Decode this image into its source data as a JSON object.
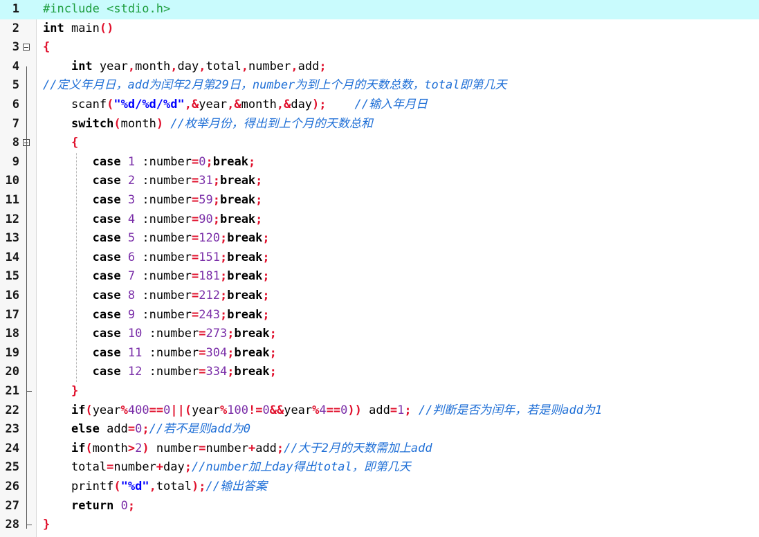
{
  "editor": {
    "current_line": 1,
    "lines": [
      {
        "num": "1",
        "segs": [
          {
            "t": "pp",
            "v": "#include <stdio.h>"
          }
        ]
      },
      {
        "num": "2",
        "segs": [
          {
            "t": "k",
            "v": "int"
          },
          {
            "t": "plain",
            "v": " main"
          },
          {
            "t": "o",
            "v": "()"
          }
        ]
      },
      {
        "num": "3",
        "fold": "open",
        "segs": [
          {
            "t": "o",
            "v": "{"
          }
        ]
      },
      {
        "num": "4",
        "segs": [
          {
            "t": "plain",
            "v": "    "
          },
          {
            "t": "k",
            "v": "int"
          },
          {
            "t": "plain",
            "v": " year"
          },
          {
            "t": "o",
            "v": ","
          },
          {
            "t": "plain",
            "v": "month"
          },
          {
            "t": "o",
            "v": ","
          },
          {
            "t": "plain",
            "v": "day"
          },
          {
            "t": "o",
            "v": ","
          },
          {
            "t": "plain",
            "v": "total"
          },
          {
            "t": "o",
            "v": ","
          },
          {
            "t": "plain",
            "v": "number"
          },
          {
            "t": "o",
            "v": ","
          },
          {
            "t": "plain",
            "v": "add"
          },
          {
            "t": "o",
            "v": ";"
          }
        ]
      },
      {
        "num": "5",
        "segs": [
          {
            "t": "c",
            "v": "//定义年月日，add为闰年2月第29日，number为到上个月的天数总数，total即第几天"
          }
        ]
      },
      {
        "num": "6",
        "segs": [
          {
            "t": "plain",
            "v": "    scanf"
          },
          {
            "t": "o",
            "v": "("
          },
          {
            "t": "s",
            "v": "\"%d/%d/%d\""
          },
          {
            "t": "o",
            "v": ",&"
          },
          {
            "t": "plain",
            "v": "year"
          },
          {
            "t": "o",
            "v": ",&"
          },
          {
            "t": "plain",
            "v": "month"
          },
          {
            "t": "o",
            "v": ",&"
          },
          {
            "t": "plain",
            "v": "day"
          },
          {
            "t": "o",
            "v": ");"
          },
          {
            "t": "plain",
            "v": "    "
          },
          {
            "t": "c",
            "v": "//输入年月日"
          }
        ]
      },
      {
        "num": "7",
        "segs": [
          {
            "t": "plain",
            "v": "    "
          },
          {
            "t": "k",
            "v": "switch"
          },
          {
            "t": "o",
            "v": "("
          },
          {
            "t": "plain",
            "v": "month"
          },
          {
            "t": "o",
            "v": ")"
          },
          {
            "t": "plain",
            "v": " "
          },
          {
            "t": "c",
            "v": "//枚举月份，得出到上个月的天数总和"
          }
        ]
      },
      {
        "num": "8",
        "fold": "open",
        "segs": [
          {
            "t": "plain",
            "v": "    "
          },
          {
            "t": "o",
            "v": "{"
          }
        ]
      },
      {
        "num": "9",
        "segs": [
          {
            "t": "plain",
            "v": "       "
          },
          {
            "t": "k",
            "v": "case"
          },
          {
            "t": "plain",
            "v": " "
          },
          {
            "t": "n",
            "v": "1"
          },
          {
            "t": "plain",
            "v": " :number"
          },
          {
            "t": "o",
            "v": "="
          },
          {
            "t": "n",
            "v": "0"
          },
          {
            "t": "o",
            "v": ";"
          },
          {
            "t": "k",
            "v": "break"
          },
          {
            "t": "o",
            "v": ";"
          }
        ]
      },
      {
        "num": "10",
        "segs": [
          {
            "t": "plain",
            "v": "       "
          },
          {
            "t": "k",
            "v": "case"
          },
          {
            "t": "plain",
            "v": " "
          },
          {
            "t": "n",
            "v": "2"
          },
          {
            "t": "plain",
            "v": " :number"
          },
          {
            "t": "o",
            "v": "="
          },
          {
            "t": "n",
            "v": "31"
          },
          {
            "t": "o",
            "v": ";"
          },
          {
            "t": "k",
            "v": "break"
          },
          {
            "t": "o",
            "v": ";"
          }
        ]
      },
      {
        "num": "11",
        "segs": [
          {
            "t": "plain",
            "v": "       "
          },
          {
            "t": "k",
            "v": "case"
          },
          {
            "t": "plain",
            "v": " "
          },
          {
            "t": "n",
            "v": "3"
          },
          {
            "t": "plain",
            "v": " :number"
          },
          {
            "t": "o",
            "v": "="
          },
          {
            "t": "n",
            "v": "59"
          },
          {
            "t": "o",
            "v": ";"
          },
          {
            "t": "k",
            "v": "break"
          },
          {
            "t": "o",
            "v": ";"
          }
        ]
      },
      {
        "num": "12",
        "segs": [
          {
            "t": "plain",
            "v": "       "
          },
          {
            "t": "k",
            "v": "case"
          },
          {
            "t": "plain",
            "v": " "
          },
          {
            "t": "n",
            "v": "4"
          },
          {
            "t": "plain",
            "v": " :number"
          },
          {
            "t": "o",
            "v": "="
          },
          {
            "t": "n",
            "v": "90"
          },
          {
            "t": "o",
            "v": ";"
          },
          {
            "t": "k",
            "v": "break"
          },
          {
            "t": "o",
            "v": ";"
          }
        ]
      },
      {
        "num": "13",
        "segs": [
          {
            "t": "plain",
            "v": "       "
          },
          {
            "t": "k",
            "v": "case"
          },
          {
            "t": "plain",
            "v": " "
          },
          {
            "t": "n",
            "v": "5"
          },
          {
            "t": "plain",
            "v": " :number"
          },
          {
            "t": "o",
            "v": "="
          },
          {
            "t": "n",
            "v": "120"
          },
          {
            "t": "o",
            "v": ";"
          },
          {
            "t": "k",
            "v": "break"
          },
          {
            "t": "o",
            "v": ";"
          }
        ]
      },
      {
        "num": "14",
        "segs": [
          {
            "t": "plain",
            "v": "       "
          },
          {
            "t": "k",
            "v": "case"
          },
          {
            "t": "plain",
            "v": " "
          },
          {
            "t": "n",
            "v": "6"
          },
          {
            "t": "plain",
            "v": " :number"
          },
          {
            "t": "o",
            "v": "="
          },
          {
            "t": "n",
            "v": "151"
          },
          {
            "t": "o",
            "v": ";"
          },
          {
            "t": "k",
            "v": "break"
          },
          {
            "t": "o",
            "v": ";"
          }
        ]
      },
      {
        "num": "15",
        "segs": [
          {
            "t": "plain",
            "v": "       "
          },
          {
            "t": "k",
            "v": "case"
          },
          {
            "t": "plain",
            "v": " "
          },
          {
            "t": "n",
            "v": "7"
          },
          {
            "t": "plain",
            "v": " :number"
          },
          {
            "t": "o",
            "v": "="
          },
          {
            "t": "n",
            "v": "181"
          },
          {
            "t": "o",
            "v": ";"
          },
          {
            "t": "k",
            "v": "break"
          },
          {
            "t": "o",
            "v": ";"
          }
        ]
      },
      {
        "num": "16",
        "segs": [
          {
            "t": "plain",
            "v": "       "
          },
          {
            "t": "k",
            "v": "case"
          },
          {
            "t": "plain",
            "v": " "
          },
          {
            "t": "n",
            "v": "8"
          },
          {
            "t": "plain",
            "v": " :number"
          },
          {
            "t": "o",
            "v": "="
          },
          {
            "t": "n",
            "v": "212"
          },
          {
            "t": "o",
            "v": ";"
          },
          {
            "t": "k",
            "v": "break"
          },
          {
            "t": "o",
            "v": ";"
          }
        ]
      },
      {
        "num": "17",
        "segs": [
          {
            "t": "plain",
            "v": "       "
          },
          {
            "t": "k",
            "v": "case"
          },
          {
            "t": "plain",
            "v": " "
          },
          {
            "t": "n",
            "v": "9"
          },
          {
            "t": "plain",
            "v": " :number"
          },
          {
            "t": "o",
            "v": "="
          },
          {
            "t": "n",
            "v": "243"
          },
          {
            "t": "o",
            "v": ";"
          },
          {
            "t": "k",
            "v": "break"
          },
          {
            "t": "o",
            "v": ";"
          }
        ]
      },
      {
        "num": "18",
        "segs": [
          {
            "t": "plain",
            "v": "       "
          },
          {
            "t": "k",
            "v": "case"
          },
          {
            "t": "plain",
            "v": " "
          },
          {
            "t": "n",
            "v": "10"
          },
          {
            "t": "plain",
            "v": " :number"
          },
          {
            "t": "o",
            "v": "="
          },
          {
            "t": "n",
            "v": "273"
          },
          {
            "t": "o",
            "v": ";"
          },
          {
            "t": "k",
            "v": "break"
          },
          {
            "t": "o",
            "v": ";"
          }
        ]
      },
      {
        "num": "19",
        "segs": [
          {
            "t": "plain",
            "v": "       "
          },
          {
            "t": "k",
            "v": "case"
          },
          {
            "t": "plain",
            "v": " "
          },
          {
            "t": "n",
            "v": "11"
          },
          {
            "t": "plain",
            "v": " :number"
          },
          {
            "t": "o",
            "v": "="
          },
          {
            "t": "n",
            "v": "304"
          },
          {
            "t": "o",
            "v": ";"
          },
          {
            "t": "k",
            "v": "break"
          },
          {
            "t": "o",
            "v": ";"
          }
        ]
      },
      {
        "num": "20",
        "segs": [
          {
            "t": "plain",
            "v": "       "
          },
          {
            "t": "k",
            "v": "case"
          },
          {
            "t": "plain",
            "v": " "
          },
          {
            "t": "n",
            "v": "12"
          },
          {
            "t": "plain",
            "v": " :number"
          },
          {
            "t": "o",
            "v": "="
          },
          {
            "t": "n",
            "v": "334"
          },
          {
            "t": "o",
            "v": ";"
          },
          {
            "t": "k",
            "v": "break"
          },
          {
            "t": "o",
            "v": ";"
          }
        ]
      },
      {
        "num": "21",
        "fold": "end",
        "segs": [
          {
            "t": "plain",
            "v": "    "
          },
          {
            "t": "o",
            "v": "}"
          }
        ]
      },
      {
        "num": "22",
        "segs": [
          {
            "t": "plain",
            "v": "    "
          },
          {
            "t": "k",
            "v": "if"
          },
          {
            "t": "o",
            "v": "("
          },
          {
            "t": "plain",
            "v": "year"
          },
          {
            "t": "o",
            "v": "%"
          },
          {
            "t": "n",
            "v": "400"
          },
          {
            "t": "o",
            "v": "=="
          },
          {
            "t": "n",
            "v": "0"
          },
          {
            "t": "o",
            "v": "||("
          },
          {
            "t": "plain",
            "v": "year"
          },
          {
            "t": "o",
            "v": "%"
          },
          {
            "t": "n",
            "v": "100"
          },
          {
            "t": "o",
            "v": "!="
          },
          {
            "t": "n",
            "v": "0"
          },
          {
            "t": "o",
            "v": "&&"
          },
          {
            "t": "plain",
            "v": "year"
          },
          {
            "t": "o",
            "v": "%"
          },
          {
            "t": "n",
            "v": "4"
          },
          {
            "t": "o",
            "v": "=="
          },
          {
            "t": "n",
            "v": "0"
          },
          {
            "t": "o",
            "v": "))"
          },
          {
            "t": "plain",
            "v": " add"
          },
          {
            "t": "o",
            "v": "="
          },
          {
            "t": "n",
            "v": "1"
          },
          {
            "t": "o",
            "v": ";"
          },
          {
            "t": "plain",
            "v": " "
          },
          {
            "t": "c",
            "v": "//判断是否为闰年，若是则add为1"
          }
        ]
      },
      {
        "num": "23",
        "segs": [
          {
            "t": "plain",
            "v": "    "
          },
          {
            "t": "k",
            "v": "else"
          },
          {
            "t": "plain",
            "v": " add"
          },
          {
            "t": "o",
            "v": "="
          },
          {
            "t": "n",
            "v": "0"
          },
          {
            "t": "o",
            "v": ";"
          },
          {
            "t": "c",
            "v": "//若不是则add为0"
          }
        ]
      },
      {
        "num": "24",
        "segs": [
          {
            "t": "plain",
            "v": "    "
          },
          {
            "t": "k",
            "v": "if"
          },
          {
            "t": "o",
            "v": "("
          },
          {
            "t": "plain",
            "v": "month"
          },
          {
            "t": "o",
            "v": ">"
          },
          {
            "t": "n",
            "v": "2"
          },
          {
            "t": "o",
            "v": ")"
          },
          {
            "t": "plain",
            "v": " number"
          },
          {
            "t": "o",
            "v": "="
          },
          {
            "t": "plain",
            "v": "number"
          },
          {
            "t": "o",
            "v": "+"
          },
          {
            "t": "plain",
            "v": "add"
          },
          {
            "t": "o",
            "v": ";"
          },
          {
            "t": "c",
            "v": "//大于2月的天数需加上add"
          }
        ]
      },
      {
        "num": "25",
        "segs": [
          {
            "t": "plain",
            "v": "    total"
          },
          {
            "t": "o",
            "v": "="
          },
          {
            "t": "plain",
            "v": "number"
          },
          {
            "t": "o",
            "v": "+"
          },
          {
            "t": "plain",
            "v": "day"
          },
          {
            "t": "o",
            "v": ";"
          },
          {
            "t": "c",
            "v": "//number加上day得出total，即第几天"
          }
        ]
      },
      {
        "num": "26",
        "segs": [
          {
            "t": "plain",
            "v": "    printf"
          },
          {
            "t": "o",
            "v": "("
          },
          {
            "t": "s",
            "v": "\"%d\""
          },
          {
            "t": "o",
            "v": ","
          },
          {
            "t": "plain",
            "v": "total"
          },
          {
            "t": "o",
            "v": ");"
          },
          {
            "t": "c",
            "v": "//输出答案"
          }
        ]
      },
      {
        "num": "27",
        "segs": [
          {
            "t": "plain",
            "v": "    "
          },
          {
            "t": "k",
            "v": "return"
          },
          {
            "t": "plain",
            "v": " "
          },
          {
            "t": "n",
            "v": "0"
          },
          {
            "t": "o",
            "v": ";"
          }
        ]
      },
      {
        "num": "28",
        "fold": "end",
        "segs": [
          {
            "t": "o",
            "v": "}"
          }
        ]
      }
    ]
  },
  "colors": {
    "current_line_bg": "#c9fbfd",
    "keyword": "#000000",
    "number": "#7a2ea8",
    "string": "#0000ff",
    "operator": "#e0102c",
    "preprocessor": "#1e9e3f",
    "comment": "#1f6fd6"
  }
}
